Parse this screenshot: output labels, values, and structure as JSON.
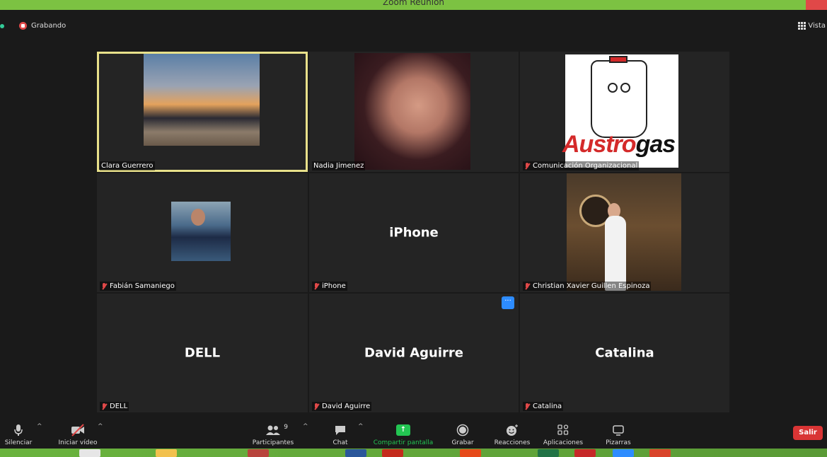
{
  "window": {
    "title": "Zoom Reunión"
  },
  "status": {
    "recording_label": "Grabando",
    "view_label": "Vista"
  },
  "tiles": [
    {
      "name": "Clara Guerrero",
      "muted": false,
      "active": true,
      "kind": "video-sunset"
    },
    {
      "name": "Nadia Jimenez",
      "muted": false,
      "active": false,
      "kind": "video-portrait"
    },
    {
      "name": "Comunicación Organizacional",
      "muted": true,
      "active": false,
      "kind": "logo",
      "logo_text_a": "Austro",
      "logo_text_b": "gas"
    },
    {
      "name": "Fabián Samaniego",
      "muted": true,
      "active": false,
      "kind": "photo"
    },
    {
      "name": "iPhone",
      "display": "iPhone",
      "muted": true,
      "active": false,
      "kind": "text"
    },
    {
      "name": "Christian Xavier Guillen Espinoza",
      "muted": true,
      "active": false,
      "kind": "photo-tall"
    },
    {
      "name": "DELL",
      "display": "DELL",
      "muted": true,
      "active": false,
      "kind": "text"
    },
    {
      "name": "David Aguirre",
      "display": "David Aguirre",
      "muted": true,
      "active": false,
      "kind": "text",
      "more_button": "···"
    },
    {
      "name": "Catalina",
      "display": "Catalina",
      "muted": true,
      "active": false,
      "kind": "text"
    }
  ],
  "toolbar": {
    "mute_label": "Silenciar",
    "video_label": "Iniciar vídeo",
    "participants_label": "Participantes",
    "participants_count": "9",
    "chat_label": "Chat",
    "share_label": "Compartir pantalla",
    "record_label": "Grabar",
    "reactions_label": "Reacciones",
    "apps_label": "Aplicaciones",
    "whiteboards_label": "Pizarras",
    "leave_label": "Salir"
  },
  "colors": {
    "accent_green": "#23c552",
    "leave_red": "#d93535",
    "active_border": "#e8e08a",
    "muted_red": "#e04848"
  }
}
